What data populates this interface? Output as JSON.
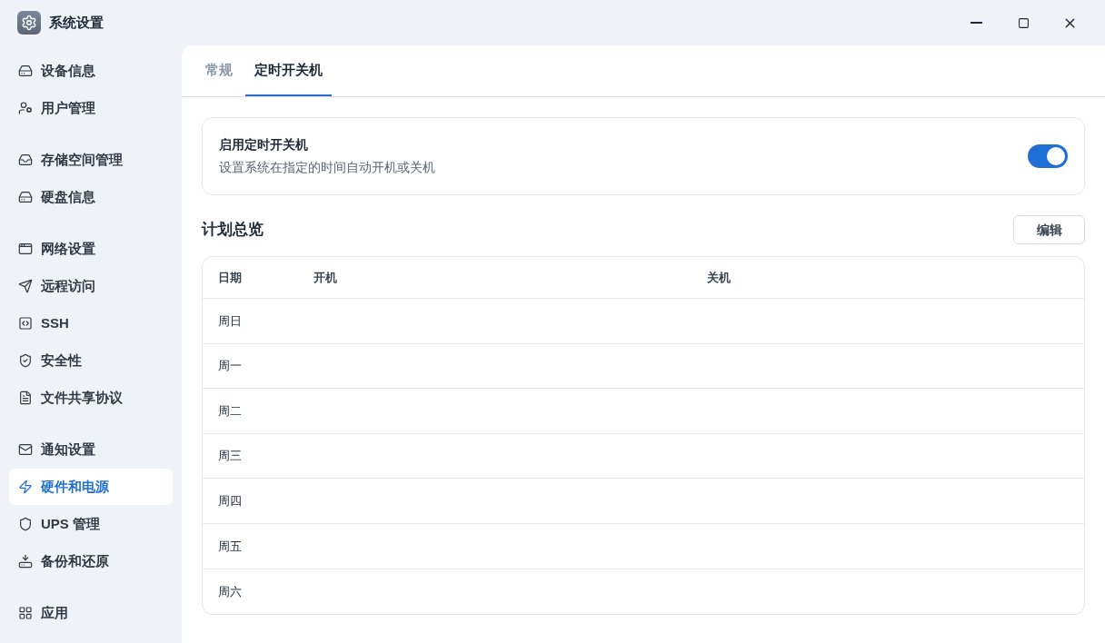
{
  "window": {
    "title": "系统设置"
  },
  "sidebar": {
    "groups": [
      [
        {
          "label": "设备信息",
          "selected": false
        },
        {
          "label": "用户管理",
          "selected": false
        }
      ],
      [
        {
          "label": "存储空间管理",
          "selected": false
        },
        {
          "label": "硬盘信息",
          "selected": false
        }
      ],
      [
        {
          "label": "网络设置",
          "selected": false
        },
        {
          "label": "远程访问",
          "selected": false
        },
        {
          "label": "SSH",
          "selected": false
        },
        {
          "label": "安全性",
          "selected": false
        },
        {
          "label": "文件共享协议",
          "selected": false
        }
      ],
      [
        {
          "label": "通知设置",
          "selected": false
        },
        {
          "label": "硬件和电源",
          "selected": true
        },
        {
          "label": "UPS 管理",
          "selected": false
        },
        {
          "label": "备份和还原",
          "selected": false
        }
      ],
      [
        {
          "label": "应用",
          "selected": false
        }
      ]
    ]
  },
  "tabs": [
    {
      "label": "常规",
      "selected": false
    },
    {
      "label": "定时开关机",
      "selected": true
    }
  ],
  "schedule_toggle": {
    "title": "启用定时开关机",
    "description": "设置系统在指定的时间自动开机或关机",
    "on": true
  },
  "plan": {
    "title": "计划总览",
    "edit_button": "编辑"
  },
  "table": {
    "columns": [
      "日期",
      "开机",
      "关机"
    ],
    "rows": [
      [
        "周日"
      ],
      [
        "周一"
      ],
      [
        "周二"
      ],
      [
        "周三"
      ],
      [
        "周四"
      ],
      [
        "周五"
      ],
      [
        "周六"
      ]
    ]
  }
}
